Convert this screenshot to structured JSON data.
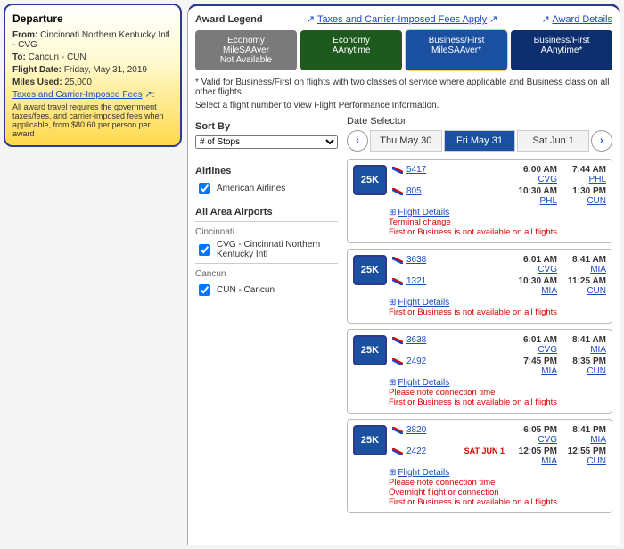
{
  "departure": {
    "heading": "Departure",
    "from_label": "From:",
    "from_value": "Cincinnati Northern Kentucky Intl - CVG",
    "to_label": "To:",
    "to_value": "Cancun - CUN",
    "date_label": "Flight Date:",
    "date_value": "Friday, May 31, 2019",
    "miles_label": "Miles Used:",
    "miles_value": "25,000",
    "tax_link": "Taxes and Carrier-Imposed Fees",
    "tax_desc": "All award travel requires the government taxes/fees, and carrier-imposed fees when applicable, from $80.60 per person per award"
  },
  "legend": {
    "title": "Award Legend",
    "taxes_note": "Taxes and Carrier-Imposed Fees Apply",
    "details_link": "Award Details"
  },
  "cabins": [
    {
      "line1": "Economy",
      "line2": "MileSAAver",
      "line3": "Not Available"
    },
    {
      "line1": "Economy",
      "line2": "AAnytime",
      "line3": ""
    },
    {
      "line1": "Business/First",
      "line2": "MileSAAver*",
      "line3": ""
    },
    {
      "line1": "Business/First",
      "line2": "AAnytime*",
      "line3": ""
    }
  ],
  "notes": {
    "valid": "* Valid for Business/First on flights with two classes of service where applicable and Business class on all other flights.",
    "select": "Select a flight number to view Flight Performance Information."
  },
  "sort": {
    "title": "Sort By",
    "value": "# of Stops"
  },
  "filters": {
    "airlines_title": "Airlines",
    "airline_0": "American Airlines",
    "airports_title": "All Area Airports",
    "origin_city": "Cincinnati",
    "origin_apt": "CVG - Cincinnati Northern Kentucky Intl",
    "dest_city": "Cancun",
    "dest_apt": "CUN - Cancun"
  },
  "date_selector": {
    "title": "Date Selector",
    "d0": "Thu May 30",
    "d1": "Fri May 31",
    "d2": "Sat Jun 1"
  },
  "flight_details_label": "Flight Details",
  "flights": [
    {
      "badge": "25K",
      "s0": {
        "num": "5417",
        "dep_time": "6:00 AM",
        "dep_apt": "CVG",
        "arr_time": "7:44 AM",
        "arr_apt": "PHL"
      },
      "s1": {
        "num": "805",
        "dep_time": "10:30 AM",
        "dep_apt": "PHL",
        "arr_time": "1:30 PM",
        "arr_apt": "CUN"
      },
      "warn0": "Terminal change",
      "warn1": "First or Business is not available on all flights"
    },
    {
      "badge": "25K",
      "s0": {
        "num": "3638",
        "dep_time": "6:01 AM",
        "dep_apt": "CVG",
        "arr_time": "8:41 AM",
        "arr_apt": "MIA"
      },
      "s1": {
        "num": "1321",
        "dep_time": "10:30 AM",
        "dep_apt": "MIA",
        "arr_time": "11:25 AM",
        "arr_apt": "CUN"
      },
      "warn0": "First or Business is not available on all flights"
    },
    {
      "badge": "25K",
      "s0": {
        "num": "3638",
        "dep_time": "6:01 AM",
        "dep_apt": "CVG",
        "arr_time": "8:41 AM",
        "arr_apt": "MIA"
      },
      "s1": {
        "num": "2492",
        "dep_time": "7:45 PM",
        "dep_apt": "MIA",
        "arr_time": "8:35 PM",
        "arr_apt": "CUN"
      },
      "warn0": "Please note connection time",
      "warn1": "First or Business is not available on all flights"
    },
    {
      "badge": "25K",
      "s0": {
        "num": "3820",
        "dep_time": "6:05 PM",
        "dep_apt": "CVG",
        "arr_time": "8:41 PM",
        "arr_apt": "MIA"
      },
      "s1": {
        "num": "2422",
        "dep_time": "12:05 PM",
        "dep_apt": "MIA",
        "arr_time": "12:55 PM",
        "arr_apt": "CUN",
        "next_day": "SAT JUN 1"
      },
      "warn0": "Please note connection time",
      "warn1": "Overnight flight or connection",
      "warn2": "First or Business is not available on all flights"
    }
  ]
}
